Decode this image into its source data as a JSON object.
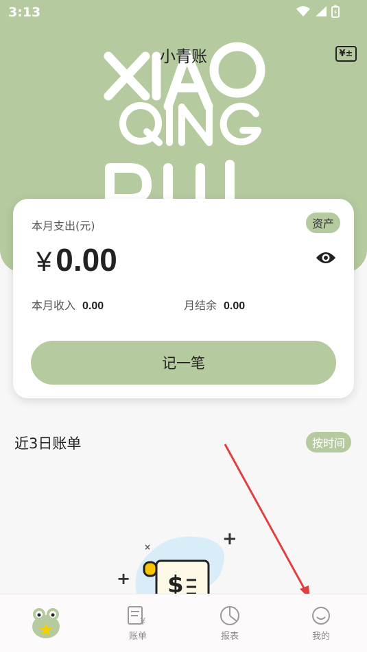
{
  "status_bar": {
    "time": "3:13"
  },
  "header": {
    "title": "小青账",
    "calculator_label": "¥±",
    "brand_logo_text": "XIAO QING BU"
  },
  "summary": {
    "expense_label": "本月支出(元)",
    "asset_button": "资产",
    "currency": "¥",
    "expense_amount": "0.00",
    "income_label": "本月收入",
    "income_value": "0.00",
    "balance_label": "月结余",
    "balance_value": "0.00",
    "record_button": "记一笔"
  },
  "recent": {
    "title": "近3日账单",
    "sort_button": "按时间"
  },
  "tabbar": {
    "items": [
      {
        "label": "",
        "icon": "frog-mascot-icon"
      },
      {
        "label": "账单",
        "icon": "bill-icon"
      },
      {
        "label": "报表",
        "icon": "pie-chart-icon"
      },
      {
        "label": "我的",
        "icon": "smiley-icon"
      }
    ]
  },
  "colors": {
    "accent": "#b5ca9f",
    "annotation_arrow": "#e04040"
  }
}
